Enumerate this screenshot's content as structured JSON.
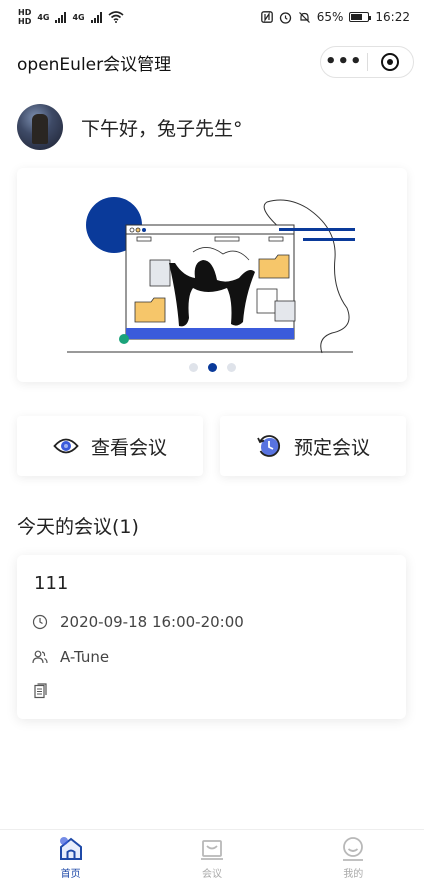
{
  "status_bar": {
    "network_1": "4G",
    "network_2": "4G",
    "battery_percent": "65%",
    "battery_level": 0.65,
    "time": "16:22",
    "icons": [
      "hd-icon",
      "signal-icon",
      "wifi-icon",
      "nfc-icon",
      "alarm-icon",
      "mute-icon",
      "battery-icon"
    ]
  },
  "nav": {
    "title": "openEuler会议管理",
    "menu_icon": "more-dots-icon",
    "close_icon": "target-circle-icon"
  },
  "greeting": {
    "text": "下午好，兔子先生°"
  },
  "banner": {
    "slide_count": 3,
    "active_slide": 2,
    "colors": {
      "accent": "#0a3a9a",
      "blue_bar": "#3b5bdb",
      "folder": "#f6c66a"
    }
  },
  "actions": {
    "view_label": "查看会议",
    "view_icon": "eye-icon",
    "book_label": "预定会议",
    "book_icon": "clock-refresh-icon"
  },
  "today": {
    "title": "今天的会议(1)",
    "meetings": [
      {
        "name": "111",
        "time": "2020-09-18 16:00-20:00",
        "group": "A-Tune",
        "notes": ""
      }
    ]
  },
  "tabbar": {
    "items": [
      {
        "label": "首页",
        "icon": "home-icon",
        "active": true
      },
      {
        "label": "会议",
        "icon": "meeting-icon",
        "active": false
      },
      {
        "label": "我的",
        "icon": "profile-icon",
        "active": false
      }
    ],
    "active_color": "#1f4aa8"
  }
}
